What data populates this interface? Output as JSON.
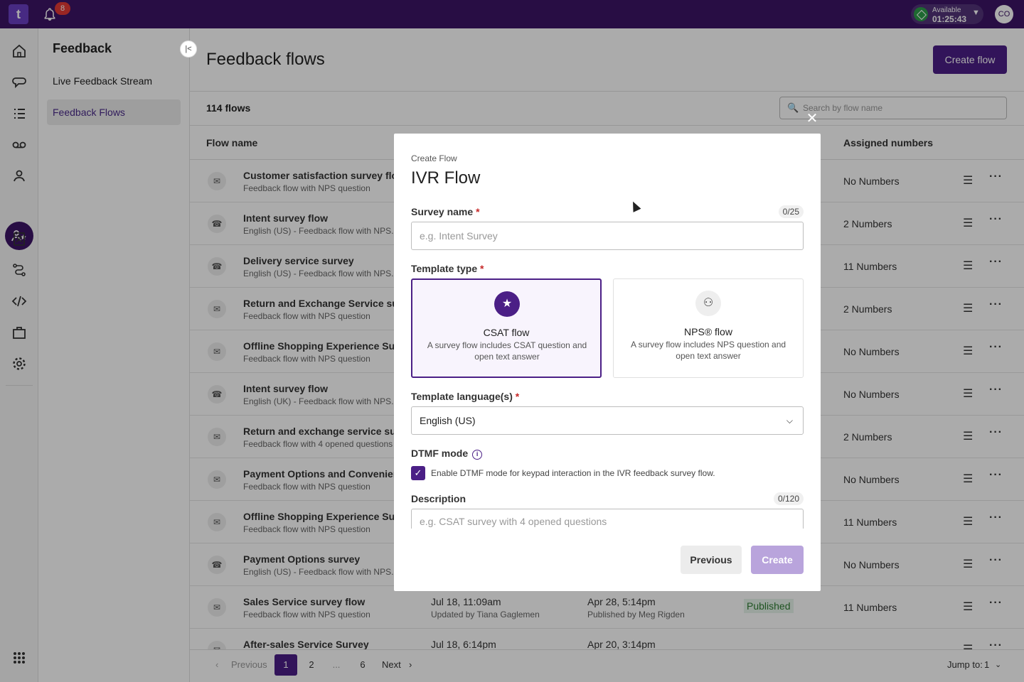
{
  "topbar": {
    "notification_count": "8",
    "status_label": "Available",
    "status_timer": "01:25:43",
    "avatar_initials": "CO"
  },
  "sidebar": {
    "title": "Feedback",
    "items": [
      {
        "label": "Live Feedback Stream"
      },
      {
        "label": "Feedback Flows"
      }
    ]
  },
  "main": {
    "title": "Feedback flows",
    "create_label": "Create flow",
    "count_label": "114 flows",
    "search_placeholder": "Search by flow name",
    "columns": {
      "flow_name": "Flow name",
      "assigned_numbers": "Assigned numbers"
    },
    "rows": [
      {
        "name": "Customer satisfaction survey flow",
        "desc": "Feedback flow with NPS question",
        "type": "chat",
        "updated": "",
        "updated_by": "",
        "published": "",
        "published_by": "",
        "status": "",
        "numbers": "No Numbers"
      },
      {
        "name": "Intent survey flow",
        "desc": "English (US) - Feedback flow with NPS...",
        "type": "phone",
        "updated": "",
        "updated_by": "",
        "published": "",
        "published_by": "",
        "status": "",
        "numbers": "2 Numbers"
      },
      {
        "name": "Delivery service survey",
        "desc": "English (US) - Feedback flow with NPS...",
        "type": "phone",
        "updated": "",
        "updated_by": "",
        "published": "",
        "published_by": "",
        "status": "",
        "numbers": "11 Numbers"
      },
      {
        "name": "Return and Exchange Service survey",
        "desc": "Feedback flow with NPS question",
        "type": "chat",
        "updated": "",
        "updated_by": "",
        "published": "",
        "published_by": "",
        "status": "",
        "numbers": "2 Numbers"
      },
      {
        "name": "Offline Shopping Experience Survey",
        "desc": "Feedback flow with NPS question",
        "type": "chat",
        "updated": "",
        "updated_by": "",
        "published": "",
        "published_by": "",
        "status": "",
        "numbers": "No Numbers"
      },
      {
        "name": "Intent survey flow",
        "desc": "English (UK) - Feedback flow with NPS...",
        "type": "phone",
        "updated": "",
        "updated_by": "",
        "published": "",
        "published_by": "",
        "status": "",
        "numbers": "No Numbers"
      },
      {
        "name": "Return and exchange service survey",
        "desc": "Feedback flow with 4 opened questions",
        "type": "chat",
        "updated": "",
        "updated_by": "",
        "published": "",
        "published_by": "",
        "status": "",
        "numbers": "2 Numbers"
      },
      {
        "name": "Payment Options and Convenience",
        "desc": "Feedback flow with NPS question",
        "type": "chat",
        "updated": "",
        "updated_by": "",
        "published": "",
        "published_by": "",
        "status": "",
        "numbers": "No Numbers"
      },
      {
        "name": "Offline Shopping Experience Survey",
        "desc": "Feedback flow with NPS question",
        "type": "chat",
        "updated": "",
        "updated_by": "",
        "published": "",
        "published_by": "",
        "status": "",
        "numbers": "11 Numbers"
      },
      {
        "name": "Payment Options survey",
        "desc": "English (US) - Feedback flow with NPS...",
        "type": "phone",
        "updated": "",
        "updated_by": "",
        "published": "",
        "published_by": "",
        "status": "",
        "numbers": "No Numbers"
      },
      {
        "name": "Sales Service survey flow",
        "desc": "Feedback flow with NPS question",
        "type": "chat",
        "updated": "Jul 18, 11:09am",
        "updated_by": "Updated by Tiana Gaglemen",
        "published": "Apr 28, 5:14pm",
        "published_by": "Published by Meg Rigden",
        "status": "Published",
        "numbers": "11 Numbers"
      },
      {
        "name": "After-sales Service Survey",
        "desc": "",
        "type": "chat",
        "updated": "Jul 18, 6:14pm",
        "updated_by": "",
        "published": "Apr 20, 3:14pm",
        "published_by": "",
        "status": "",
        "numbers": ""
      }
    ]
  },
  "pager": {
    "previous": "Previous",
    "pages": [
      "1",
      "2",
      "...",
      "6"
    ],
    "next": "Next",
    "jump_label": "Jump to:",
    "jump_value": "1"
  },
  "modal": {
    "subtitle": "Create Flow",
    "title": "IVR Flow",
    "survey_name_label": "Survey name",
    "survey_name_counter": "0/25",
    "survey_name_placeholder": "e.g. Intent Survey",
    "template_type_label": "Template type",
    "cards": [
      {
        "title": "CSAT flow",
        "desc": "A survey flow includes CSAT question and open text answer",
        "icon": "star-icon"
      },
      {
        "title": "NPS® flow",
        "desc": "A survey flow includes NPS question and open text answer",
        "icon": "speaking-person-icon"
      }
    ],
    "language_label": "Template language(s)",
    "language_value": "English (US)",
    "dtmf_label": "DTMF mode",
    "dtmf_text": "Enable DTMF mode for keypad interaction in the IVR feedback survey flow.",
    "dtmf_checked": true,
    "description_label": "Description",
    "description_counter": "0/120",
    "description_placeholder": "e.g. CSAT survey with 4 opened questions",
    "previous_label": "Previous",
    "create_label": "Create"
  },
  "colors": {
    "brand": "#3d1466",
    "accent": "#4b1f86",
    "published": "#2e7d32"
  }
}
